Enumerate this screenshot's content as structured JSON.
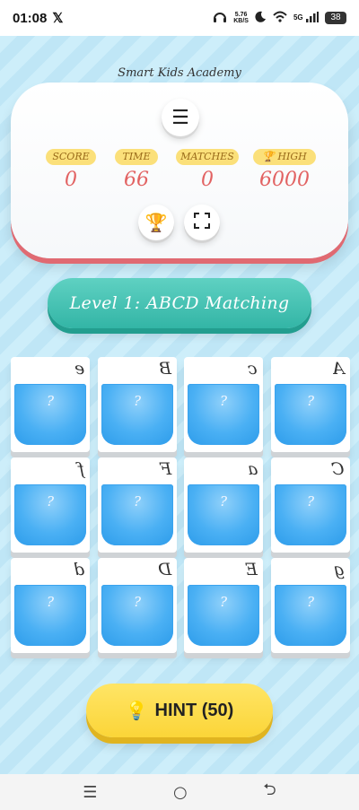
{
  "status_bar": {
    "time": "01:08",
    "x_logo": "𝕏",
    "net_speed_top": "5.76",
    "net_speed_bottom": "KB/S",
    "signal": "5G",
    "battery": "38"
  },
  "header": {
    "academy": "Smart Kids Academy",
    "menu_icon": "☰",
    "stats": [
      {
        "label": "SCORE",
        "value": "0"
      },
      {
        "label": "TIME",
        "value": "66"
      },
      {
        "label": "MATCHES",
        "value": "0"
      },
      {
        "label": "🏆 HIGH",
        "value": "6000"
      }
    ],
    "trophy_icon": "🏆",
    "fullscreen_icon": "⛶"
  },
  "level": {
    "title": "Level 1: ABCD Matching"
  },
  "cards": [
    {
      "glyph": "e",
      "hidden": "?"
    },
    {
      "glyph": "B",
      "hidden": "?"
    },
    {
      "glyph": "c",
      "hidden": "?"
    },
    {
      "glyph": "A",
      "hidden": "?"
    },
    {
      "glyph": "f",
      "hidden": "?"
    },
    {
      "glyph": "F",
      "hidden": "?"
    },
    {
      "glyph": "a",
      "hidden": "?"
    },
    {
      "glyph": "C",
      "hidden": "?"
    },
    {
      "glyph": "d",
      "hidden": "?"
    },
    {
      "glyph": "D",
      "hidden": "?"
    },
    {
      "glyph": "E",
      "hidden": "?"
    },
    {
      "glyph": "g",
      "hidden": "?"
    }
  ],
  "hint": {
    "icon": "💡",
    "label": "HINT (50)"
  },
  "nav": {
    "menu": "☰",
    "home": "○",
    "back": "⮌"
  }
}
